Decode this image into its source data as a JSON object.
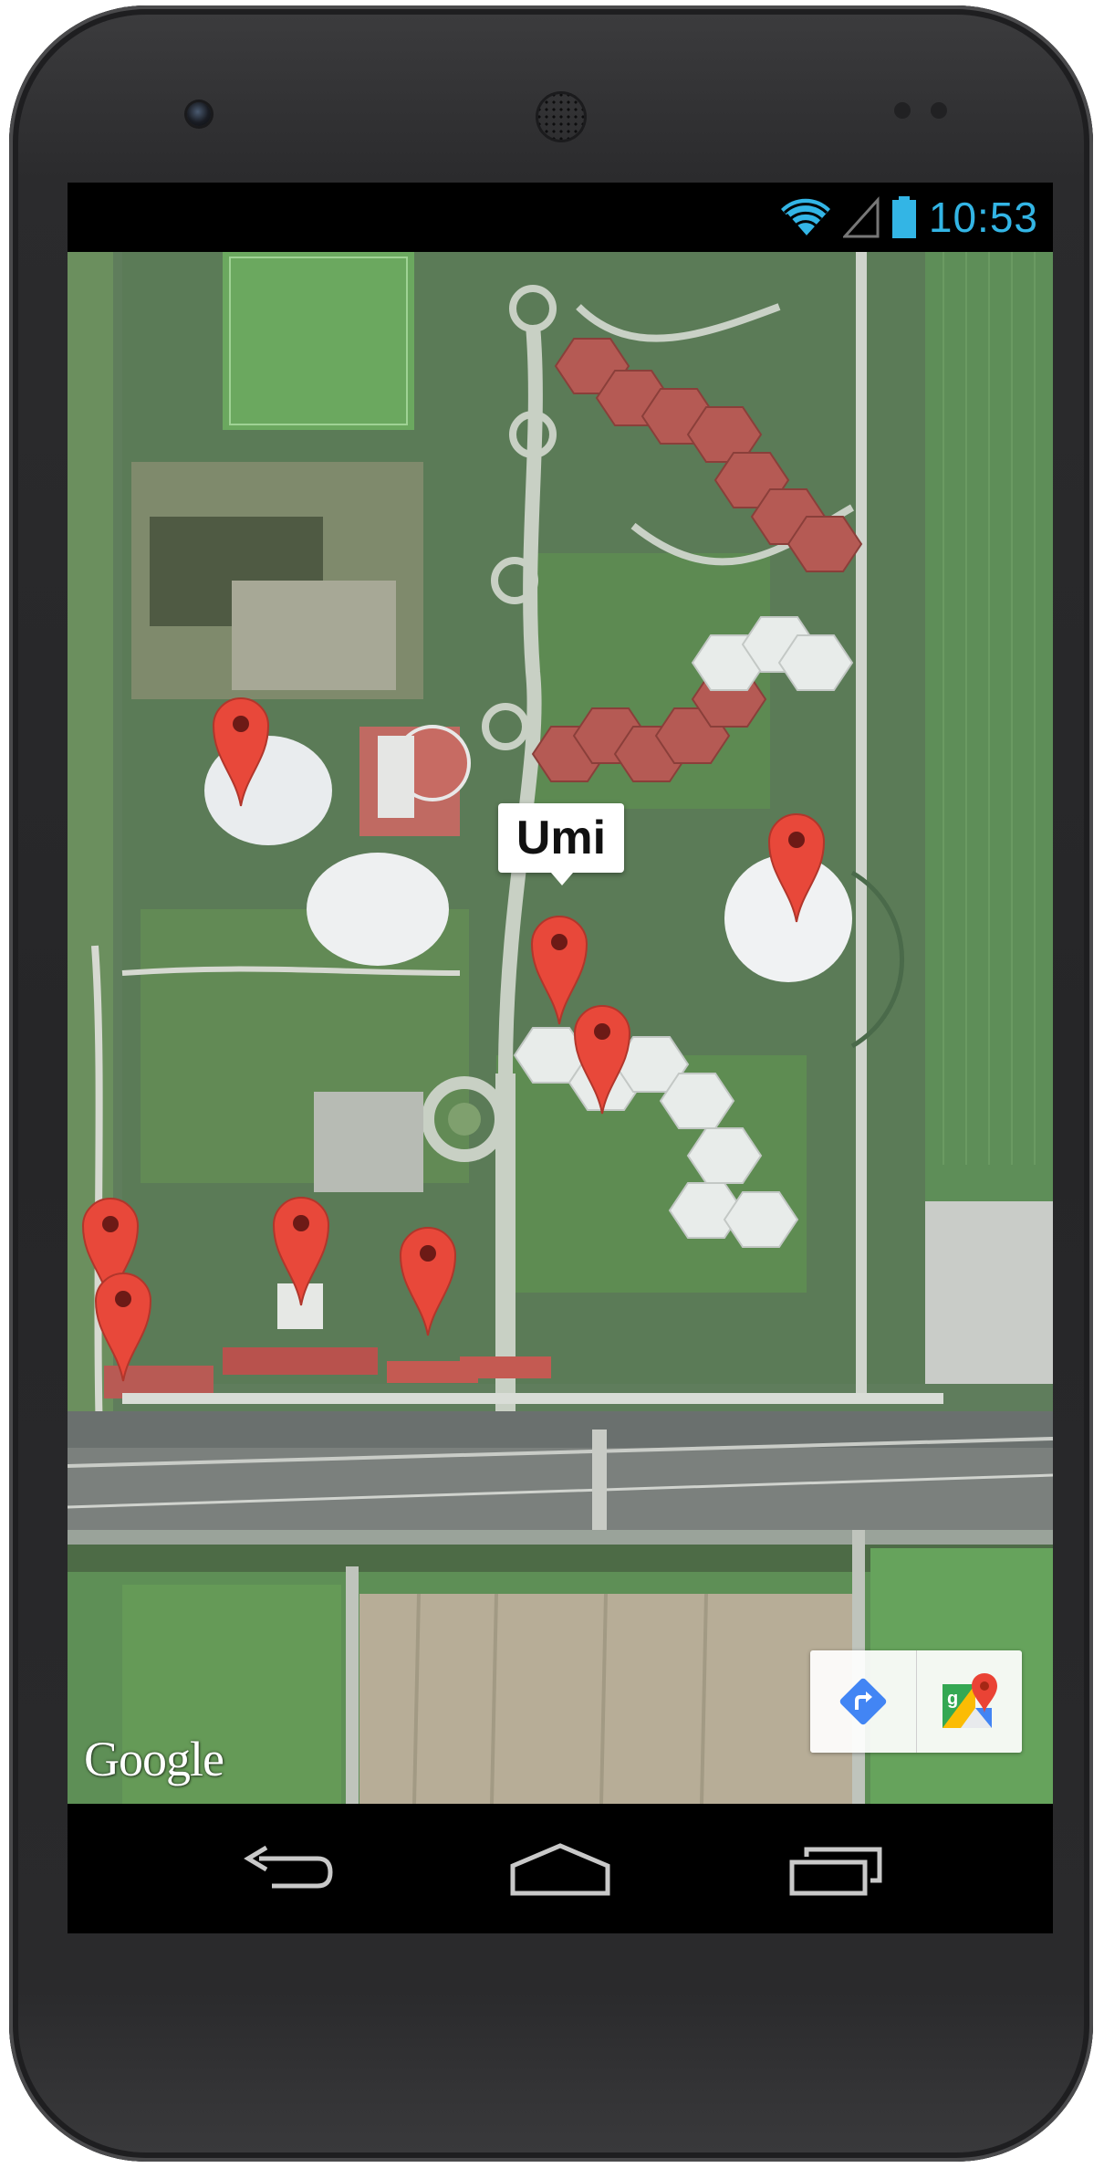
{
  "status_bar": {
    "time": "10:53",
    "icons": [
      "wifi-icon",
      "cell-signal-icon",
      "battery-icon"
    ],
    "accent_color": "#33b5e5"
  },
  "map": {
    "provider_logo": "Google",
    "map_type": "satellite",
    "info_window": {
      "title": "Umi"
    },
    "marker_color": "#e8483a",
    "markers": [
      {
        "id": "marker-1"
      },
      {
        "id": "marker-2"
      },
      {
        "id": "marker-umi",
        "selected": true
      },
      {
        "id": "marker-4"
      },
      {
        "id": "marker-5"
      },
      {
        "id": "marker-6"
      },
      {
        "id": "marker-7"
      },
      {
        "id": "marker-8"
      }
    ],
    "toolbar": {
      "buttons": [
        "directions-icon",
        "google-maps-icon"
      ]
    }
  },
  "navigation_bar": {
    "buttons": [
      "back-icon",
      "home-icon",
      "recent-apps-icon"
    ]
  }
}
